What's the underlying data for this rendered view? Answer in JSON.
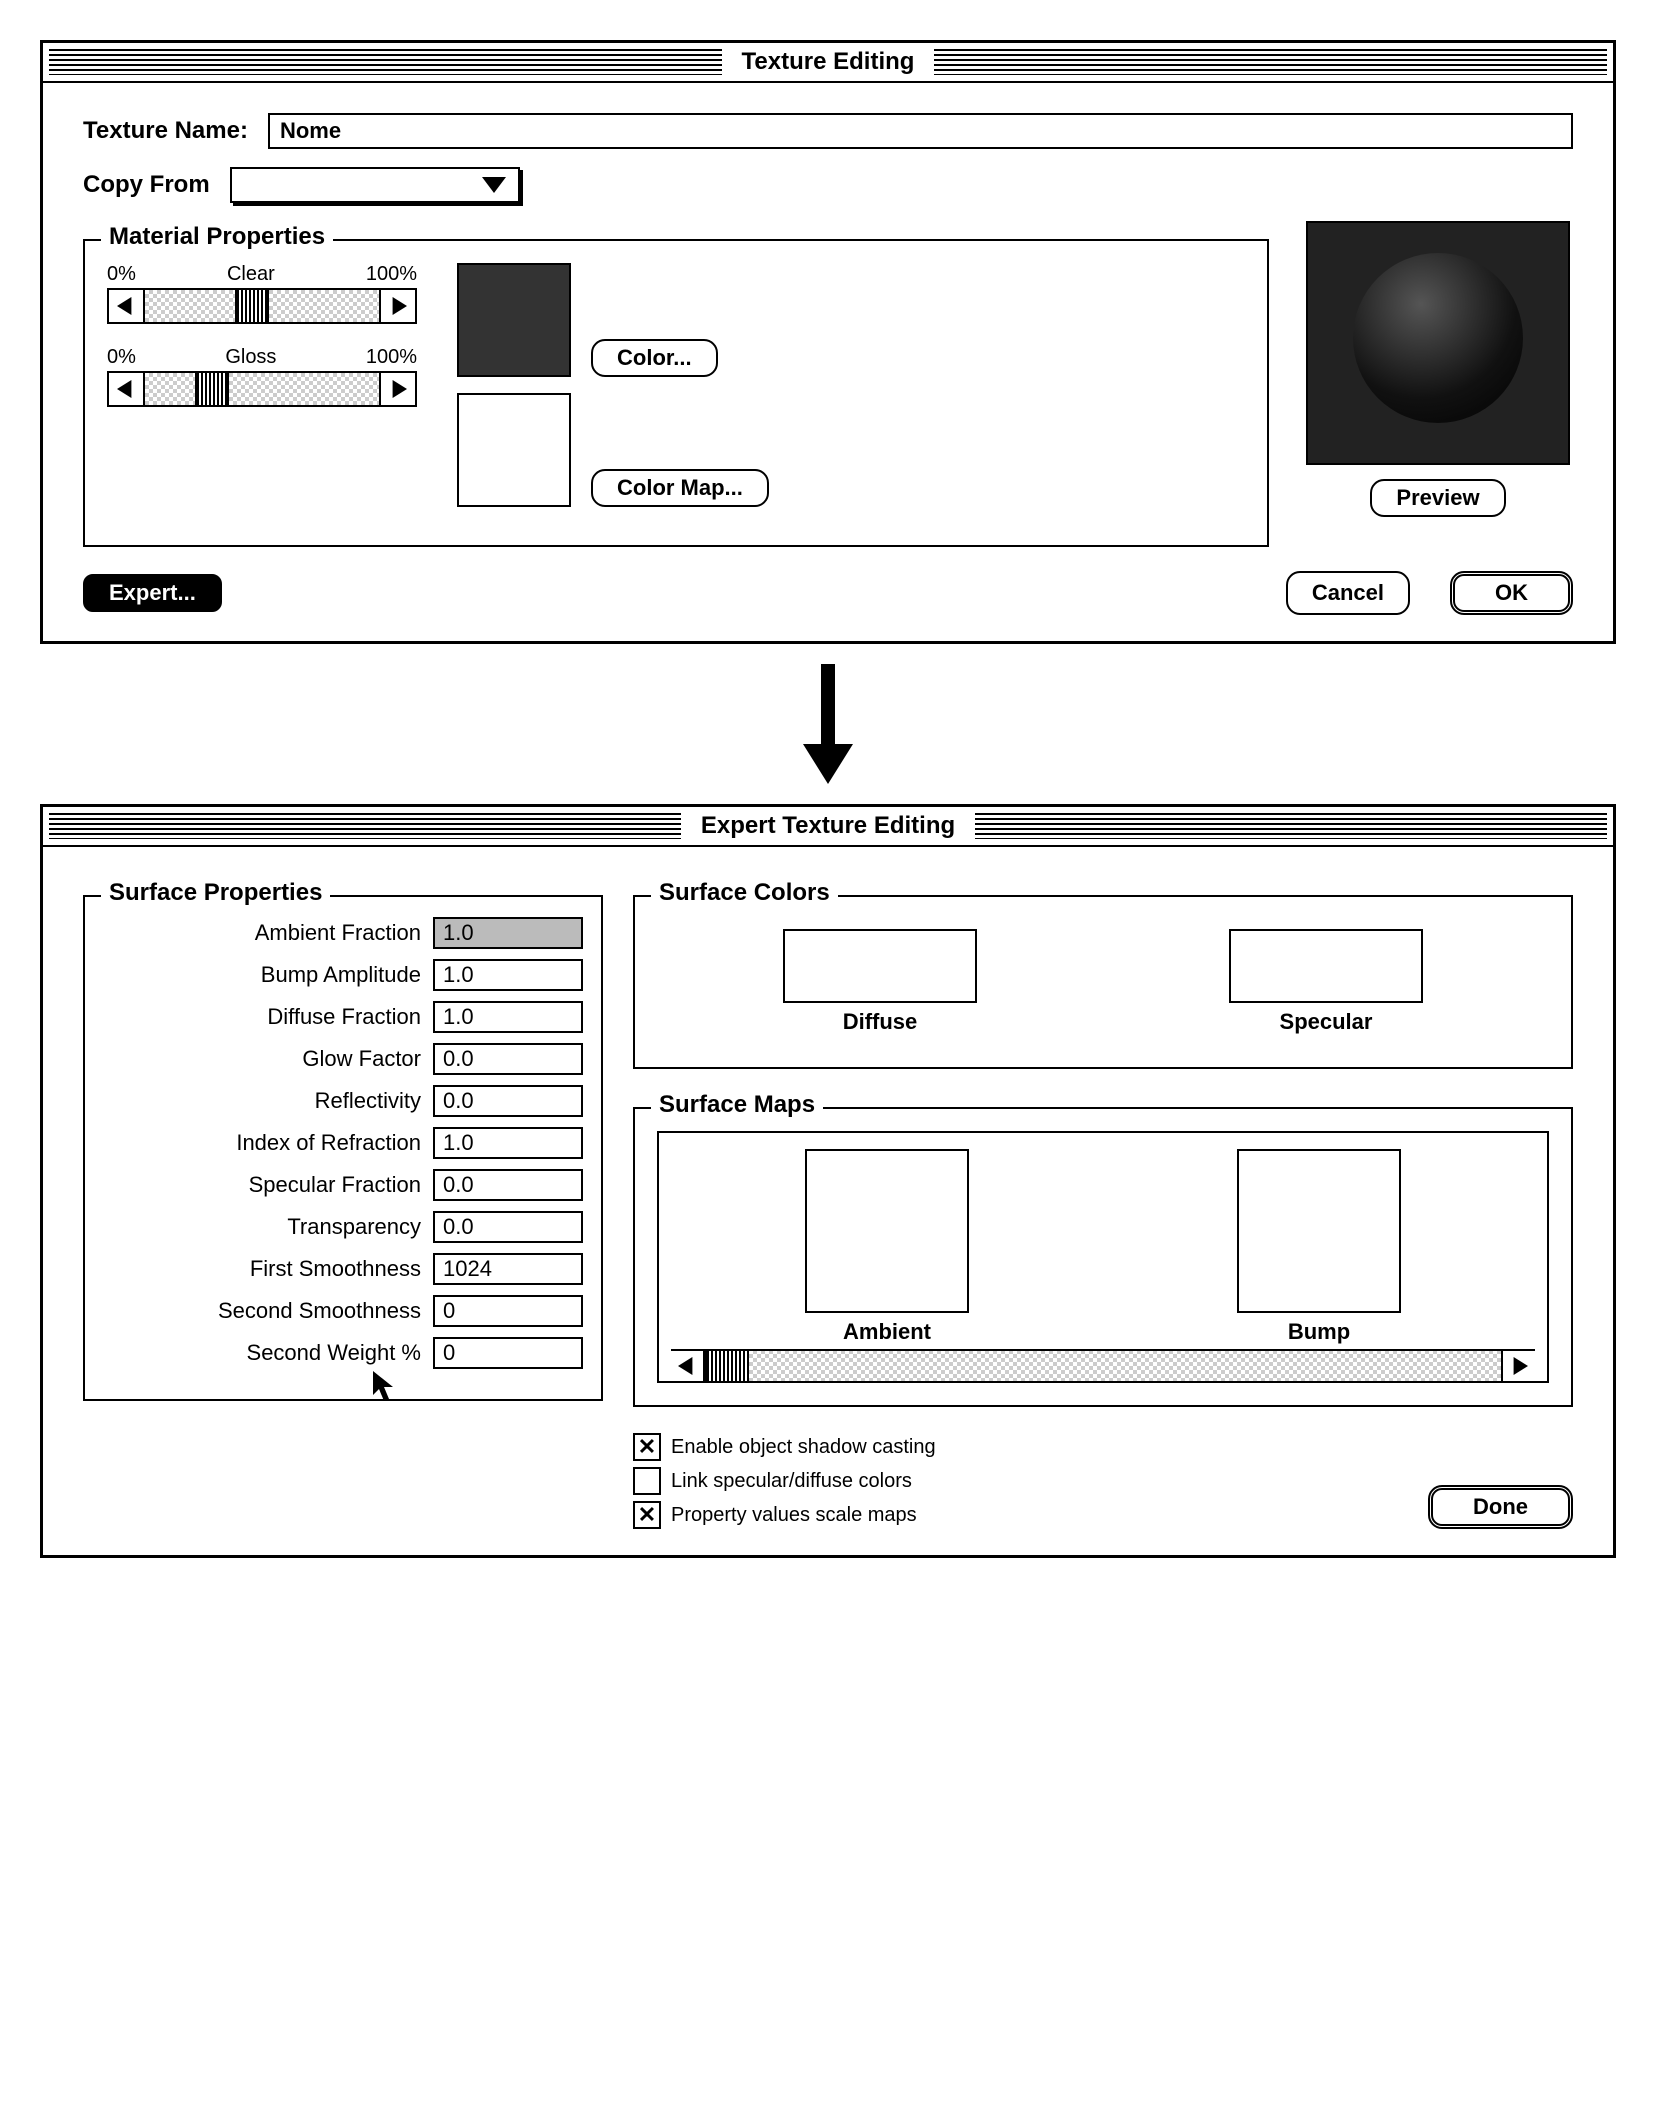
{
  "window1": {
    "title": "Texture Editing",
    "texture_name_label": "Texture Name:",
    "texture_name_value": "Nome",
    "copy_from_label": "Copy From",
    "material_properties_title": "Material Properties",
    "slider1": {
      "min": "0%",
      "label": "Clear",
      "max": "100%"
    },
    "slider2": {
      "min": "0%",
      "label": "Gloss",
      "max": "100%"
    },
    "color_button": "Color...",
    "colormap_button": "Color Map...",
    "preview_button": "Preview",
    "expert_button": "Expert...",
    "cancel_button": "Cancel",
    "ok_button": "OK"
  },
  "window2": {
    "title": "Expert Texture Editing",
    "surface_properties_title": "Surface Properties",
    "props": [
      {
        "label": "Ambient Fraction",
        "value": "1.0",
        "selected": true
      },
      {
        "label": "Bump Amplitude",
        "value": "1.0"
      },
      {
        "label": "Diffuse Fraction",
        "value": "1.0"
      },
      {
        "label": "Glow Factor",
        "value": "0.0"
      },
      {
        "label": "Reflectivity",
        "value": "0.0"
      },
      {
        "label": "Index of Refraction",
        "value": "1.0"
      },
      {
        "label": "Specular Fraction",
        "value": "0.0"
      },
      {
        "label": "Transparency",
        "value": "0.0"
      },
      {
        "label": "First Smoothness",
        "value": "1024"
      },
      {
        "label": "Second Smoothness",
        "value": "0"
      },
      {
        "label": "Second Weight %",
        "value": "0"
      }
    ],
    "surface_colors_title": "Surface Colors",
    "diffuse_label": "Diffuse",
    "specular_label": "Specular",
    "surface_maps_title": "Surface Maps",
    "ambient_label": "Ambient",
    "bump_label": "Bump",
    "check1": "Enable object shadow casting",
    "check2": "Link specular/diffuse colors",
    "check3": "Property values scale maps",
    "check1_on": true,
    "check2_on": false,
    "check3_on": true,
    "done_button": "Done"
  }
}
